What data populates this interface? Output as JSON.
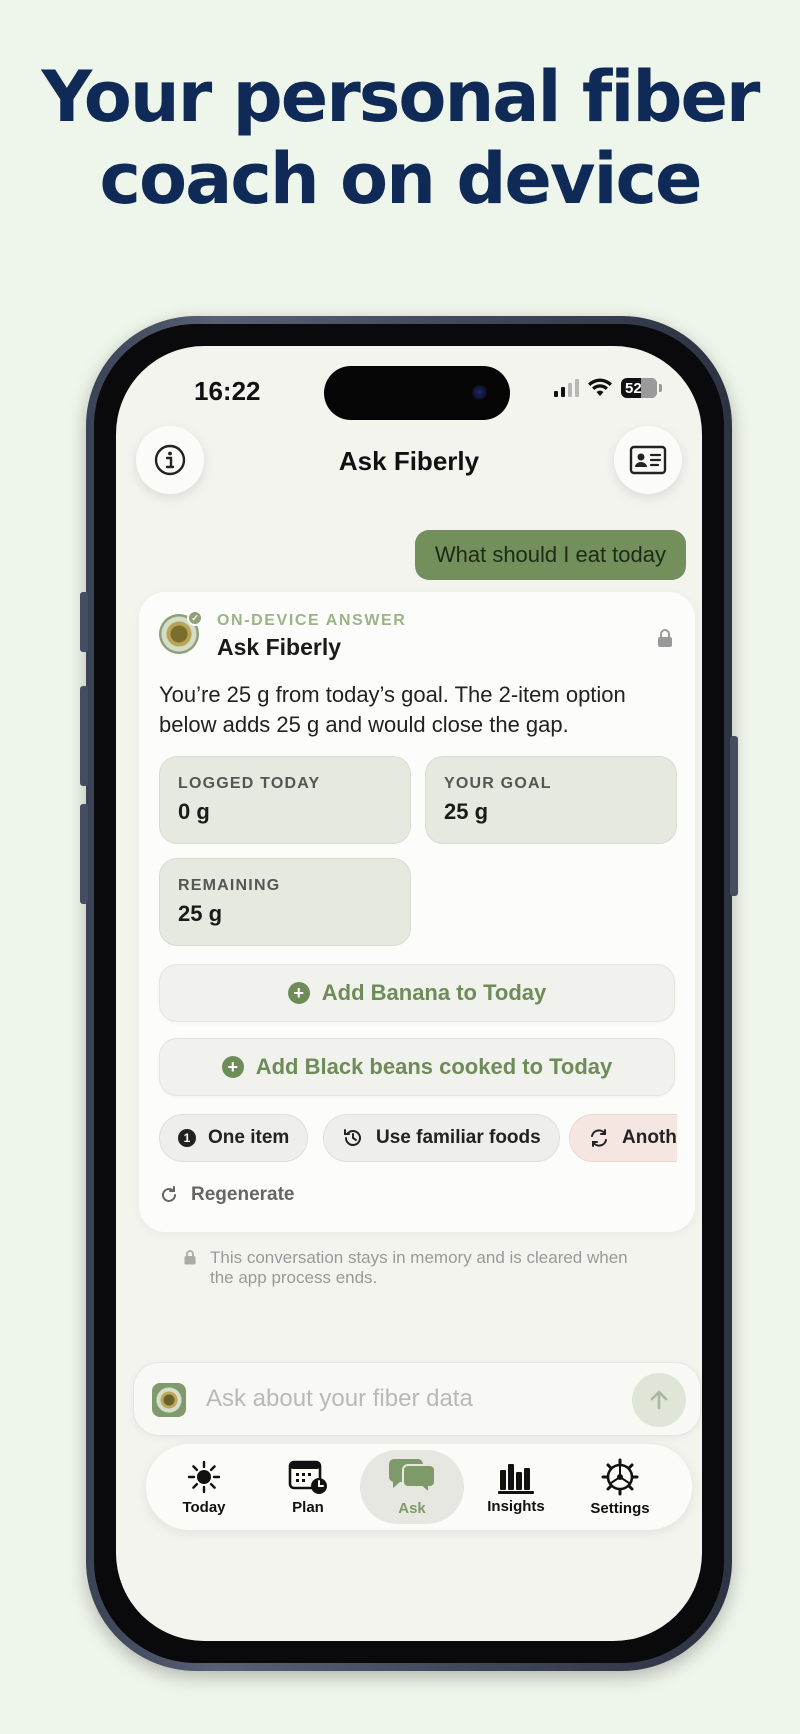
{
  "headline": {
    "line1": "Your personal fiber",
    "line2": "coach on device"
  },
  "status_bar": {
    "time": "16:22",
    "battery": "52"
  },
  "nav": {
    "title": "Ask Fiberly",
    "left_icon": "info-icon",
    "right_icon": "id-card-icon"
  },
  "chat": {
    "user_message": "What should I eat today",
    "answer": {
      "eyebrow": "ON-DEVICE ANSWER",
      "title": "Ask Fiberly",
      "body": "You’re 25 g from today’s goal. The 2-item option below adds 25 g and would close the gap.",
      "stats": [
        {
          "label": "LOGGED TODAY",
          "value": "0 g"
        },
        {
          "label": "YOUR GOAL",
          "value": "25 g"
        },
        {
          "label": "REMAINING",
          "value": "25 g"
        }
      ],
      "actions": [
        {
          "label": "Add Banana to Today"
        },
        {
          "label": "Add Black beans cooked to Today"
        }
      ],
      "chips": [
        {
          "label": "One item",
          "badge": "1"
        },
        {
          "label": "Use familiar foods"
        },
        {
          "label": "Another option"
        }
      ],
      "regenerate_label": "Regenerate"
    },
    "footnote": "This conversation stays in memory and is cleared when the app process ends."
  },
  "input": {
    "placeholder": "Ask about your fiber data"
  },
  "tabs": [
    {
      "label": "Today",
      "icon": "sun-icon"
    },
    {
      "label": "Plan",
      "icon": "calendar-clock-icon"
    },
    {
      "label": "Ask",
      "icon": "chat-bubbles-icon",
      "active": true
    },
    {
      "label": "Insights",
      "icon": "bar-chart-icon"
    },
    {
      "label": "Settings",
      "icon": "gear-icon"
    }
  ],
  "colors": {
    "headline": "#0f2a56",
    "accent": "#728f5c",
    "background": "#eef5ea"
  }
}
